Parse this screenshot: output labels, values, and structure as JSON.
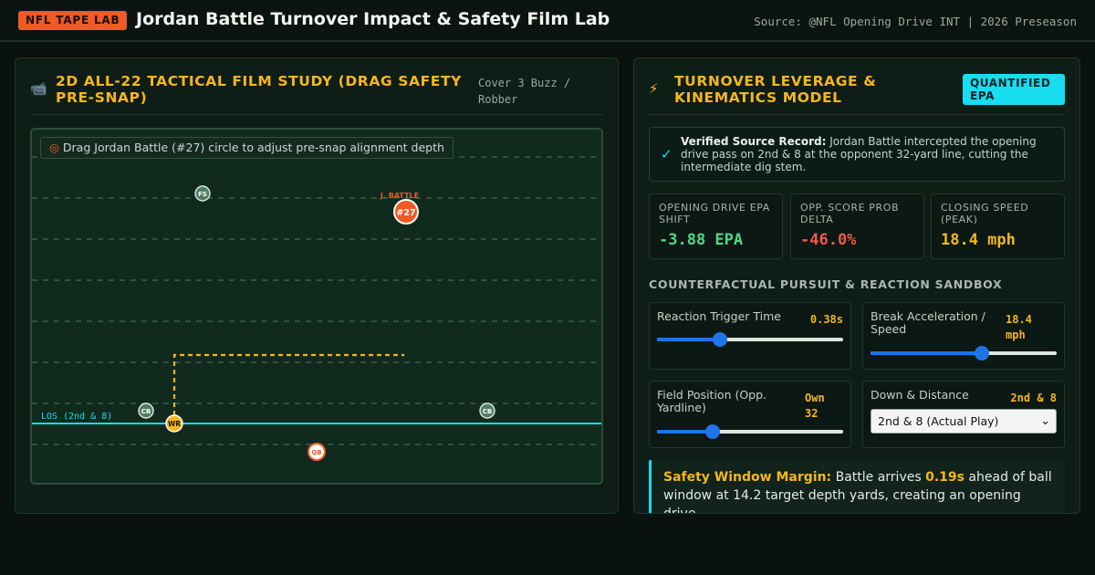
{
  "header": {
    "badge": "NFL TAPE LAB",
    "title": "Jordan Battle Turnover Impact & Safety Film Lab",
    "source": "Source: @NFL Opening Drive INT | 2026 Preseason"
  },
  "film": {
    "icon": "video-camera-icon",
    "title": "2D ALL-22 TACTICAL FILM STUDY (DRAG SAFETY PRE-SNAP)",
    "coverage": "Cover 3 Buzz / Robber",
    "hint": "Drag Jordan Battle (#27) circle to adjust pre-snap alignment depth",
    "hint_icon": "target-icon",
    "los_label": "LOS (2nd & 8)",
    "battle_tag": "J. BATTLE",
    "players": {
      "battle": "#27",
      "fs": "FS",
      "cb_left": "CB",
      "cb_right": "CB",
      "wr": "WR",
      "qb": "QB"
    },
    "colors": {
      "battle": "#f05a24",
      "wr": "#f5b71e",
      "route": "#f5b71e",
      "los": "#18dcf0"
    }
  },
  "model": {
    "icon": "lightning-icon",
    "title": "TURNOVER LEVERAGE & KINEMATICS MODEL",
    "badge": "QUANTIFIED EPA",
    "verified": {
      "icon": "checkmark-icon",
      "label": "Verified Source Record:",
      "text": "Jordan Battle intercepted the opening drive pass on 2nd & 8 at the opponent 32-yard line, cutting the intermediate dig stem."
    },
    "metrics": [
      {
        "label": "OPENING DRIVE EPA SHIFT",
        "value": "-3.88 EPA"
      },
      {
        "label": "OPP. SCORE PROB DELTA",
        "value": "-46.0%"
      },
      {
        "label": "CLOSING SPEED (PEAK)",
        "value": "18.4 mph"
      }
    ],
    "sandbox_title": "COUNTERFACTUAL PURSUIT & REACTION SANDBOX",
    "controls": {
      "reaction": {
        "label": "Reaction Trigger Time",
        "value": "0.38s",
        "level": 0.34
      },
      "speed": {
        "label": "Break Acceleration / Speed",
        "value": "18.4 mph",
        "level": 0.6
      },
      "field_pos": {
        "label": "Field Position (Opp. Yardline)",
        "value": "Own 32",
        "level": 0.3
      },
      "down": {
        "label": "Down & Distance",
        "value": "2nd & 8",
        "selected": "2nd & 8 (Actual Play)"
      }
    },
    "callout": {
      "label": "Safety Window Margin:",
      "text_a": "Battle arrives",
      "margin": "0.19s",
      "text_b": "ahead of ball window at 14.2 target depth yards, creating an opening drive"
    }
  }
}
